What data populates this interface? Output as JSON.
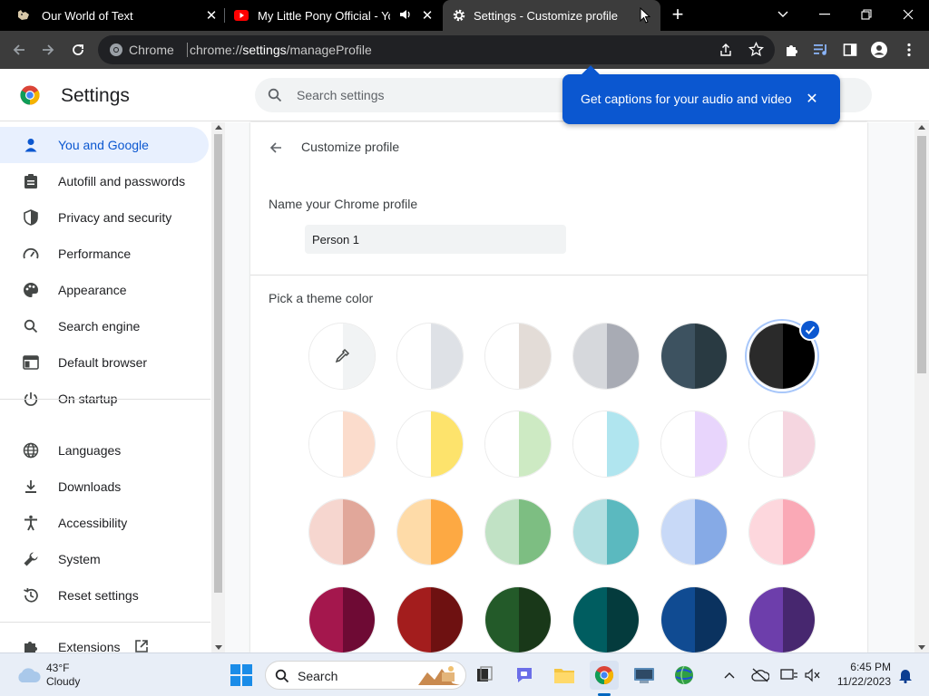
{
  "tabs": [
    {
      "title": "Our World of Text"
    },
    {
      "title": "My Little Pony Official - You"
    },
    {
      "title": "Settings - Customize profile"
    }
  ],
  "omnibox": {
    "chip": "Chrome",
    "url_scheme": "chrome://",
    "url_host": "settings",
    "url_path": "/manageProfile"
  },
  "header": {
    "title": "Settings",
    "search_placeholder": "Search settings"
  },
  "caption_bubble": {
    "text": "Get captions for your audio and video"
  },
  "sidebar": {
    "items": [
      {
        "label": "You and Google",
        "icon": "person-icon"
      },
      {
        "label": "Autofill and passwords",
        "icon": "clipboard-icon"
      },
      {
        "label": "Privacy and security",
        "icon": "shield-icon"
      },
      {
        "label": "Performance",
        "icon": "speedometer-icon"
      },
      {
        "label": "Appearance",
        "icon": "palette-icon"
      },
      {
        "label": "Search engine",
        "icon": "search-icon"
      },
      {
        "label": "Default browser",
        "icon": "browser-icon"
      },
      {
        "label": "On startup",
        "icon": "power-icon"
      },
      {
        "label": "Languages",
        "icon": "globe-icon"
      },
      {
        "label": "Downloads",
        "icon": "download-icon"
      },
      {
        "label": "Accessibility",
        "icon": "accessibility-icon"
      },
      {
        "label": "System",
        "icon": "wrench-icon"
      },
      {
        "label": "Reset settings",
        "icon": "reset-icon"
      },
      {
        "label": "Extensions",
        "icon": "puzzle-icon"
      }
    ],
    "selected_index": 0
  },
  "main": {
    "heading": "Customize profile",
    "name_label": "Name your Chrome profile",
    "name_value": "Person 1",
    "theme_label": "Pick a theme color",
    "swatches": [
      {
        "name": "custom-color-picker",
        "left": "#ffffff",
        "right": "#f1f3f4"
      },
      {
        "name": "default",
        "left": "#ffffff",
        "right": "#dee1e6"
      },
      {
        "name": "warm-grey",
        "left": "#ffffff",
        "right": "#e3dcd7"
      },
      {
        "name": "cool-grey",
        "left": "#d6d8dc",
        "right": "#a8abb4"
      },
      {
        "name": "midnight-blue",
        "left": "#3d5260",
        "right": "#293a42"
      },
      {
        "name": "black",
        "left": "#2a2a2a",
        "right": "#000000",
        "selected": true
      },
      {
        "name": "beige-white",
        "left": "#ffffff",
        "right": "#fbdccc"
      },
      {
        "name": "yellow-white",
        "left": "#ffffff",
        "right": "#fde36c"
      },
      {
        "name": "green-white",
        "left": "#ffffff",
        "right": "#cdeac3"
      },
      {
        "name": "light-teal-white",
        "left": "#ffffff",
        "right": "#b0e5ef"
      },
      {
        "name": "light-purple-white",
        "left": "#ffffff",
        "right": "#e8d5fc"
      },
      {
        "name": "pink-white",
        "left": "#ffffff",
        "right": "#f5d6e0"
      },
      {
        "name": "red",
        "left": "#f6d6cf",
        "right": "#e1a79a"
      },
      {
        "name": "yellow",
        "left": "#fedba8",
        "right": "#fda943"
      },
      {
        "name": "green",
        "left": "#c1e2c5",
        "right": "#7dbe82"
      },
      {
        "name": "light-teal",
        "left": "#b2dfe1",
        "right": "#5bb9bf"
      },
      {
        "name": "light-blue",
        "left": "#c8d9f7",
        "right": "#86aae6"
      },
      {
        "name": "pink",
        "left": "#fdd7dd",
        "right": "#faa9b6"
      },
      {
        "name": "dark-pink-red",
        "left": "#a4174d",
        "right": "#6e0a34"
      },
      {
        "name": "dark-red-orange",
        "left": "#a31d1d",
        "right": "#6e1111"
      },
      {
        "name": "dark-green",
        "left": "#235a29",
        "right": "#193819"
      },
      {
        "name": "dark-teal",
        "left": "#005d60",
        "right": "#043b3d"
      },
      {
        "name": "dark-blue",
        "left": "#104b92",
        "right": "#0a325f"
      },
      {
        "name": "purple",
        "left": "#6d3eab",
        "right": "#47276f"
      }
    ]
  },
  "taskbar": {
    "weather_temp": "43°F",
    "weather_cond": "Cloudy",
    "search_placeholder": "Search",
    "time": "6:45 PM",
    "date": "11/22/2023"
  },
  "colors": {
    "accent": "#0b57d0",
    "tab_bg": "#000000",
    "toolbar_bg": "#3c3c3c"
  }
}
